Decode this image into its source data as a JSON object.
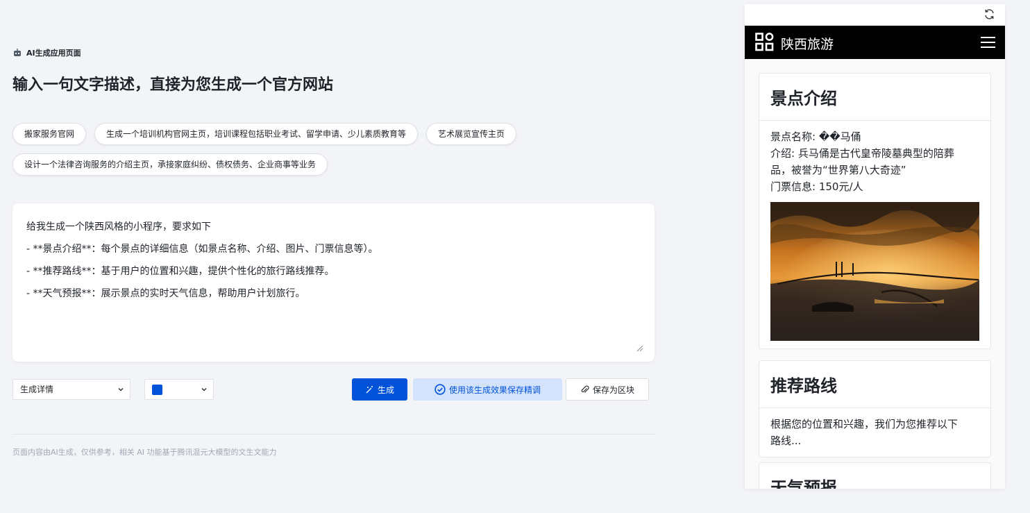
{
  "header": {
    "eyebrow": "AI生成应用页面",
    "headline": "输入一句文字描述，直接为您生成一个官方网站"
  },
  "suggestions": [
    [
      "搬家服务官网",
      "生成一个培训机构官网主页，培训课程包括职业考试、留学申请、少儿素质教育等",
      "艺术展览宣传主页"
    ],
    [
      "设计一个法律咨询服务的介绍主页，承接家庭纠纷、债权债务、企业商事等业务"
    ]
  ],
  "editor": {
    "lines": [
      "给我生成一个陕西风格的小程序，要求如下",
      "- **景点介绍**：每个景点的详细信息（如景点名称、介绍、图片、门票信息等）。",
      "- **推荐路线**：基于用户的位置和兴趣，提供个性化的旅行路线推荐。",
      "- **天气预报**：展示景点的实时天气信息，帮助用户计划旅行。"
    ]
  },
  "controls": {
    "mode_select": "生成详情",
    "color_value": "#0052d9",
    "generate_label": "生成",
    "save_tune_label": "使用该生成效果保存精调",
    "save_block_label": "保存为区块"
  },
  "footer": {
    "disclaimer": "页面内容由AI生成，仅供参考，相关 AI 功能基于腾讯混元大模型的文生文能力"
  },
  "preview": {
    "nav_title": "陕西旅游",
    "cards": [
      {
        "title": "景点介绍",
        "lines": [
          "景点名称: ��马俑",
          "介绍: 兵马俑是古代皇帝陵墓典型的陪葬",
          "品，被誉为“世界第八大奇迹”",
          "门票信息: 150元/人"
        ]
      },
      {
        "title": "推荐路线",
        "lines": [
          "根据您的位置和兴趣，我们为您推荐以下",
          "路线..."
        ]
      },
      {
        "title": "天气预报",
        "lines": []
      }
    ]
  }
}
